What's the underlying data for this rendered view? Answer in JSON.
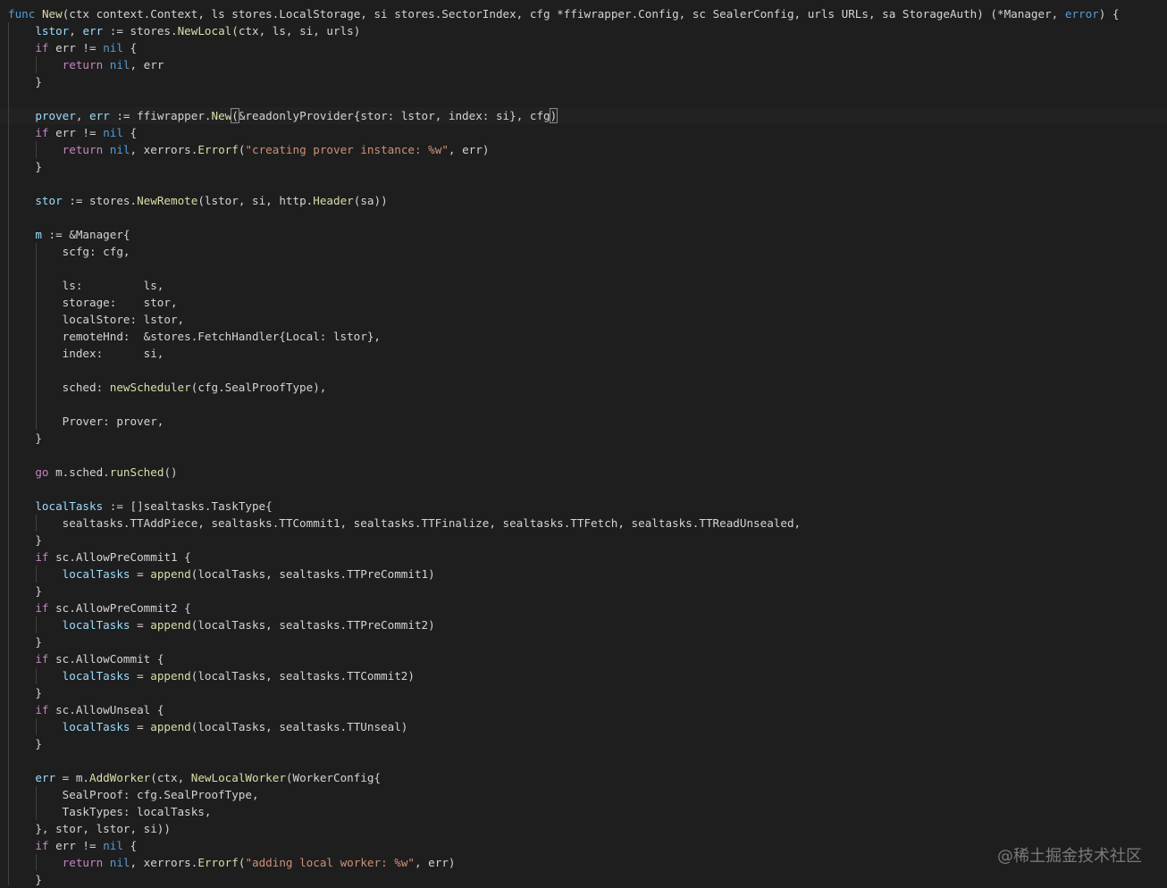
{
  "editor": {
    "language": "go",
    "theme": "dark",
    "background": "#1e1e1e",
    "token_colors": {
      "keyword": "#569cd6",
      "control": "#c586c0",
      "function": "#dcdcaa",
      "variable": "#9cdcfe",
      "string": "#ce9178",
      "type": "#4ec9b0",
      "plain": "#d4d4d4"
    },
    "lines": [
      [
        [
          "kw",
          "func"
        ],
        [
          "plain",
          " "
        ],
        [
          "fn",
          "New"
        ],
        [
          "plain",
          "(ctx context.Context, ls stores.LocalStorage, si stores.SectorIndex, cfg *ffiwrapper.Config, sc SealerConfig, urls URLs, sa StorageAuth) (*Manager, "
        ],
        [
          "kw",
          "error"
        ],
        [
          "plain",
          ") {"
        ]
      ],
      [
        [
          "plain",
          "    "
        ],
        [
          "var",
          "lstor"
        ],
        [
          "plain",
          ", "
        ],
        [
          "var",
          "err"
        ],
        [
          "plain",
          " := stores."
        ],
        [
          "fn",
          "NewLocal"
        ],
        [
          "plain",
          "(ctx, ls, si, urls)"
        ]
      ],
      [
        [
          "plain",
          "    "
        ],
        [
          "ctl",
          "if"
        ],
        [
          "plain",
          " err != "
        ],
        [
          "kw",
          "nil"
        ],
        [
          "plain",
          " {"
        ]
      ],
      [
        [
          "plain",
          "        "
        ],
        [
          "ctl",
          "return"
        ],
        [
          "plain",
          " "
        ],
        [
          "kw",
          "nil"
        ],
        [
          "plain",
          ", err"
        ]
      ],
      [
        [
          "plain",
          "    }"
        ]
      ],
      [
        [
          "plain",
          ""
        ]
      ],
      [
        [
          "plain",
          "    "
        ],
        [
          "var",
          "prover"
        ],
        [
          "plain",
          ", "
        ],
        [
          "var",
          "err"
        ],
        [
          "plain",
          " := ffiwrapper."
        ],
        [
          "fn",
          "New"
        ],
        [
          "brace",
          "("
        ],
        [
          "plain",
          "&readonlyProvider{stor: lstor, index: si}, cfg"
        ],
        [
          "brace",
          ")"
        ]
      ],
      [
        [
          "plain",
          "    "
        ],
        [
          "ctl",
          "if"
        ],
        [
          "plain",
          " err != "
        ],
        [
          "kw",
          "nil"
        ],
        [
          "plain",
          " {"
        ]
      ],
      [
        [
          "plain",
          "        "
        ],
        [
          "ctl",
          "return"
        ],
        [
          "plain",
          " "
        ],
        [
          "kw",
          "nil"
        ],
        [
          "plain",
          ", xerrors."
        ],
        [
          "fn",
          "Errorf"
        ],
        [
          "plain",
          "("
        ],
        [
          "str",
          "\"creating prover instance: %w\""
        ],
        [
          "plain",
          ", err)"
        ]
      ],
      [
        [
          "plain",
          "    }"
        ]
      ],
      [
        [
          "plain",
          ""
        ]
      ],
      [
        [
          "plain",
          "    "
        ],
        [
          "var",
          "stor"
        ],
        [
          "plain",
          " := stores."
        ],
        [
          "fn",
          "NewRemote"
        ],
        [
          "plain",
          "(lstor, si, http."
        ],
        [
          "fn",
          "Header"
        ],
        [
          "plain",
          "(sa))"
        ]
      ],
      [
        [
          "plain",
          ""
        ]
      ],
      [
        [
          "plain",
          "    "
        ],
        [
          "var",
          "m"
        ],
        [
          "plain",
          " := &Manager{"
        ]
      ],
      [
        [
          "plain",
          "        scfg: cfg,"
        ]
      ],
      [
        [
          "plain",
          ""
        ]
      ],
      [
        [
          "plain",
          "        ls:         ls,"
        ]
      ],
      [
        [
          "plain",
          "        storage:    stor,"
        ]
      ],
      [
        [
          "plain",
          "        localStore: lstor,"
        ]
      ],
      [
        [
          "plain",
          "        remoteHnd:  &stores.FetchHandler{Local: lstor},"
        ]
      ],
      [
        [
          "plain",
          "        index:      si,"
        ]
      ],
      [
        [
          "plain",
          ""
        ]
      ],
      [
        [
          "plain",
          "        sched: "
        ],
        [
          "fn",
          "newScheduler"
        ],
        [
          "plain",
          "(cfg.SealProofType),"
        ]
      ],
      [
        [
          "plain",
          ""
        ]
      ],
      [
        [
          "plain",
          "        Prover: prover,"
        ]
      ],
      [
        [
          "plain",
          "    }"
        ]
      ],
      [
        [
          "plain",
          ""
        ]
      ],
      [
        [
          "plain",
          "    "
        ],
        [
          "ctl",
          "go"
        ],
        [
          "plain",
          " m.sched."
        ],
        [
          "fn",
          "runSched"
        ],
        [
          "plain",
          "()"
        ]
      ],
      [
        [
          "plain",
          ""
        ]
      ],
      [
        [
          "plain",
          "    "
        ],
        [
          "var",
          "localTasks"
        ],
        [
          "plain",
          " := []sealtasks.TaskType{"
        ]
      ],
      [
        [
          "plain",
          "        sealtasks.TTAddPiece, sealtasks.TTCommit1, sealtasks.TTFinalize, sealtasks.TTFetch, sealtasks.TTReadUnsealed,"
        ]
      ],
      [
        [
          "plain",
          "    }"
        ]
      ],
      [
        [
          "plain",
          "    "
        ],
        [
          "ctl",
          "if"
        ],
        [
          "plain",
          " sc.AllowPreCommit1 {"
        ]
      ],
      [
        [
          "plain",
          "        "
        ],
        [
          "var",
          "localTasks"
        ],
        [
          "plain",
          " = "
        ],
        [
          "fn",
          "append"
        ],
        [
          "plain",
          "(localTasks, sealtasks.TTPreCommit1)"
        ]
      ],
      [
        [
          "plain",
          "    }"
        ]
      ],
      [
        [
          "plain",
          "    "
        ],
        [
          "ctl",
          "if"
        ],
        [
          "plain",
          " sc.AllowPreCommit2 {"
        ]
      ],
      [
        [
          "plain",
          "        "
        ],
        [
          "var",
          "localTasks"
        ],
        [
          "plain",
          " = "
        ],
        [
          "fn",
          "append"
        ],
        [
          "plain",
          "(localTasks, sealtasks.TTPreCommit2)"
        ]
      ],
      [
        [
          "plain",
          "    }"
        ]
      ],
      [
        [
          "plain",
          "    "
        ],
        [
          "ctl",
          "if"
        ],
        [
          "plain",
          " sc.AllowCommit {"
        ]
      ],
      [
        [
          "plain",
          "        "
        ],
        [
          "var",
          "localTasks"
        ],
        [
          "plain",
          " = "
        ],
        [
          "fn",
          "append"
        ],
        [
          "plain",
          "(localTasks, sealtasks.TTCommit2)"
        ]
      ],
      [
        [
          "plain",
          "    }"
        ]
      ],
      [
        [
          "plain",
          "    "
        ],
        [
          "ctl",
          "if"
        ],
        [
          "plain",
          " sc.AllowUnseal {"
        ]
      ],
      [
        [
          "plain",
          "        "
        ],
        [
          "var",
          "localTasks"
        ],
        [
          "plain",
          " = "
        ],
        [
          "fn",
          "append"
        ],
        [
          "plain",
          "(localTasks, sealtasks.TTUnseal)"
        ]
      ],
      [
        [
          "plain",
          "    }"
        ]
      ],
      [
        [
          "plain",
          ""
        ]
      ],
      [
        [
          "plain",
          "    "
        ],
        [
          "var",
          "err"
        ],
        [
          "plain",
          " = m."
        ],
        [
          "fn",
          "AddWorker"
        ],
        [
          "plain",
          "(ctx, "
        ],
        [
          "fn",
          "NewLocalWorker"
        ],
        [
          "plain",
          "(WorkerConfig{"
        ]
      ],
      [
        [
          "plain",
          "        SealProof: cfg.SealProofType,"
        ]
      ],
      [
        [
          "plain",
          "        TaskTypes: localTasks,"
        ]
      ],
      [
        [
          "plain",
          "    }, stor, lstor, si))"
        ]
      ],
      [
        [
          "plain",
          "    "
        ],
        [
          "ctl",
          "if"
        ],
        [
          "plain",
          " err != "
        ],
        [
          "kw",
          "nil"
        ],
        [
          "plain",
          " {"
        ]
      ],
      [
        [
          "plain",
          "        "
        ],
        [
          "ctl",
          "return"
        ],
        [
          "plain",
          " "
        ],
        [
          "kw",
          "nil"
        ],
        [
          "plain",
          ", xerrors."
        ],
        [
          "fn",
          "Errorf"
        ],
        [
          "plain",
          "("
        ],
        [
          "str",
          "\"adding local worker: %w\""
        ],
        [
          "plain",
          ", err)"
        ]
      ],
      [
        [
          "plain",
          "    }"
        ]
      ]
    ]
  },
  "watermark": {
    "text": "@稀土掘金技术社区"
  }
}
